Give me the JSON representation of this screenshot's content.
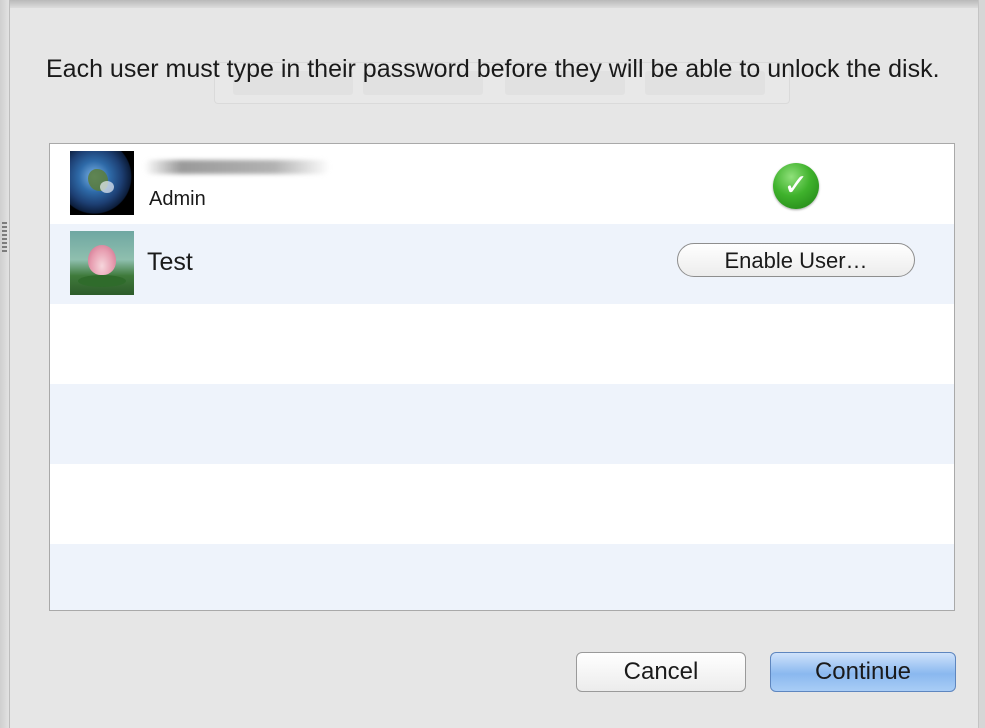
{
  "dialog": {
    "message": "Each user must type in their password before they will be able to unlock the disk."
  },
  "users": [
    {
      "avatar_icon": "earth-icon",
      "role": "Admin",
      "status_icon": "checkmark-icon",
      "status_color": "#2ea821"
    },
    {
      "avatar_icon": "lotus-icon",
      "name": "Test",
      "action_label": "Enable User…"
    }
  ],
  "buttons": {
    "cancel_label": "Cancel",
    "continue_label": "Continue"
  }
}
